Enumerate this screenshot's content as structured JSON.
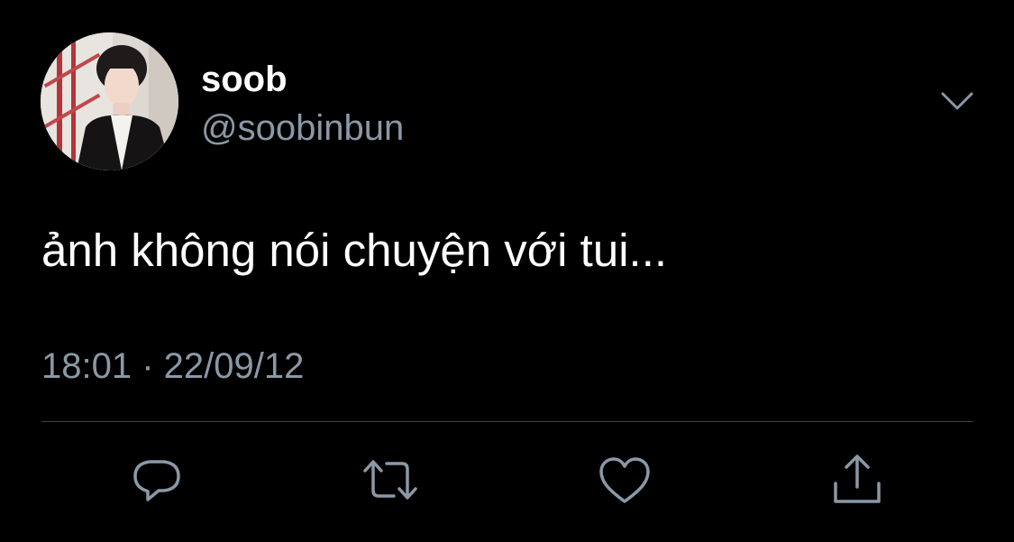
{
  "tweet": {
    "author": {
      "display_name": "soob",
      "handle": "@soobinbun"
    },
    "text": "ảnh không nói chuyện với tui...",
    "timestamp": "18:01 · 22/09/12"
  },
  "icons": {
    "menu": "chevron-down-icon",
    "reply": "reply-icon",
    "retweet": "retweet-icon",
    "like": "heart-icon",
    "share": "share-icon"
  },
  "colors": {
    "background": "#000000",
    "primary_text": "#ffffff",
    "secondary_text": "#8b98a5",
    "divider": "#38444d"
  }
}
